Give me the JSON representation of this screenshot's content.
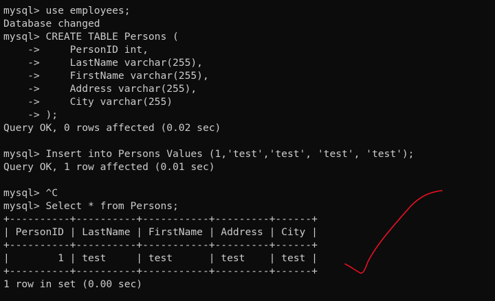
{
  "terminal": {
    "lines": [
      "",
      "mysql> use employees;",
      "Database changed",
      "mysql> CREATE TABLE Persons (",
      "    ->     PersonID int,",
      "    ->     LastName varchar(255),",
      "    ->     FirstName varchar(255),",
      "    ->     Address varchar(255),",
      "    ->     City varchar(255)",
      "    -> );",
      "Query OK, 0 rows affected (0.02 sec)",
      "",
      "mysql> Insert into Persons Values (1,'test','test', 'test', 'test');",
      "Query OK, 1 row affected (0.01 sec)",
      "",
      "mysql> ^C",
      "mysql> Select * from Persons;",
      "+----------+----------+-----------+---------+------+",
      "| PersonID | LastName | FirstName | Address | City |",
      "+----------+----------+-----------+---------+------+",
      "|        1 | test     | test      | test    | test |",
      "+----------+----------+-----------+---------+------+",
      "1 row in set (0.00 sec)"
    ]
  },
  "annotation": {
    "kind": "handwritten-checkmark",
    "color": "#e81123"
  }
}
